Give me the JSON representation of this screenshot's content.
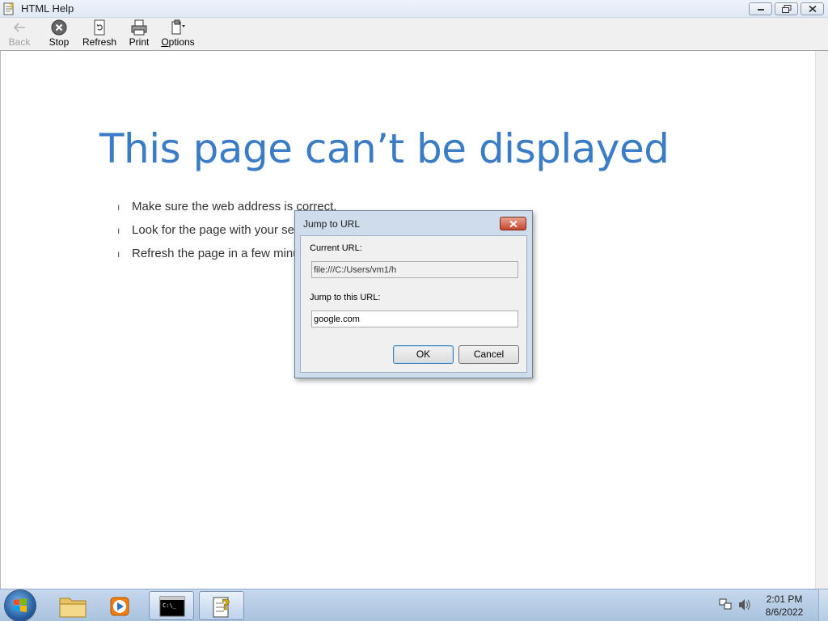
{
  "window": {
    "title": "HTML Help"
  },
  "toolbar": {
    "back": "Back",
    "stop": "Stop",
    "refresh": "Refresh",
    "print": "Print",
    "options": "Options"
  },
  "page": {
    "heading": "This page can’t be displayed",
    "tips": [
      "Make sure the web address  is correct.",
      "Look for the page with your se",
      "Refresh the page in a few minu"
    ]
  },
  "dialog": {
    "title": "Jump to URL",
    "current_label": "Current URL:",
    "current_value": "file:///C:/Users/vm1/h",
    "jump_label": "Jump to this URL:",
    "jump_value": "google.com",
    "ok": "OK",
    "cancel": "Cancel"
  },
  "taskbar": {
    "time": "2:01 PM",
    "date": "8/6/2022",
    "items": [
      "start-button",
      "file-explorer-icon",
      "media-player-icon",
      "command-prompt-icon",
      "html-help-icon"
    ]
  },
  "colors": {
    "heading": "#3a7dc6",
    "taskbar": "#b4cbe4",
    "dialog_frame": "#cfdcec"
  }
}
